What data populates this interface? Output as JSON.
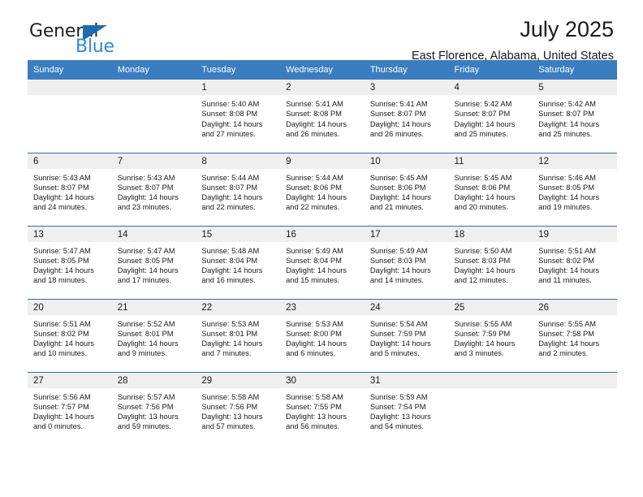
{
  "brand": {
    "name_part1": "General",
    "name_part2": "Blue",
    "triangle_icon": "triangle-icon",
    "colors": {
      "dark": "#231f20",
      "blue": "#2e8bd4",
      "triangle": "#1b6cb0"
    }
  },
  "header": {
    "title": "July 2025",
    "subtitle": "East Florence, Alabama, United States"
  },
  "theme": {
    "header_bg": "#3b7dbf",
    "row_divider": "#2f6fae",
    "daynum_bg": "#efefef"
  },
  "calendar": {
    "weekday_headers": [
      "Sunday",
      "Monday",
      "Tuesday",
      "Wednesday",
      "Thursday",
      "Friday",
      "Saturday"
    ],
    "weeks": [
      [
        {
          "day": "",
          "lines": []
        },
        {
          "day": "",
          "lines": []
        },
        {
          "day": "1",
          "lines": [
            "Sunrise: 5:40 AM",
            "Sunset: 8:08 PM",
            "Daylight: 14 hours",
            "and 27 minutes."
          ]
        },
        {
          "day": "2",
          "lines": [
            "Sunrise: 5:41 AM",
            "Sunset: 8:08 PM",
            "Daylight: 14 hours",
            "and 26 minutes."
          ]
        },
        {
          "day": "3",
          "lines": [
            "Sunrise: 5:41 AM",
            "Sunset: 8:07 PM",
            "Daylight: 14 hours",
            "and 26 minutes."
          ]
        },
        {
          "day": "4",
          "lines": [
            "Sunrise: 5:42 AM",
            "Sunset: 8:07 PM",
            "Daylight: 14 hours",
            "and 25 minutes."
          ]
        },
        {
          "day": "5",
          "lines": [
            "Sunrise: 5:42 AM",
            "Sunset: 8:07 PM",
            "Daylight: 14 hours",
            "and 25 minutes."
          ]
        }
      ],
      [
        {
          "day": "6",
          "lines": [
            "Sunrise: 5:43 AM",
            "Sunset: 8:07 PM",
            "Daylight: 14 hours",
            "and 24 minutes."
          ]
        },
        {
          "day": "7",
          "lines": [
            "Sunrise: 5:43 AM",
            "Sunset: 8:07 PM",
            "Daylight: 14 hours",
            "and 23 minutes."
          ]
        },
        {
          "day": "8",
          "lines": [
            "Sunrise: 5:44 AM",
            "Sunset: 8:07 PM",
            "Daylight: 14 hours",
            "and 22 minutes."
          ]
        },
        {
          "day": "9",
          "lines": [
            "Sunrise: 5:44 AM",
            "Sunset: 8:06 PM",
            "Daylight: 14 hours",
            "and 22 minutes."
          ]
        },
        {
          "day": "10",
          "lines": [
            "Sunrise: 5:45 AM",
            "Sunset: 8:06 PM",
            "Daylight: 14 hours",
            "and 21 minutes."
          ]
        },
        {
          "day": "11",
          "lines": [
            "Sunrise: 5:45 AM",
            "Sunset: 8:06 PM",
            "Daylight: 14 hours",
            "and 20 minutes."
          ]
        },
        {
          "day": "12",
          "lines": [
            "Sunrise: 5:46 AM",
            "Sunset: 8:05 PM",
            "Daylight: 14 hours",
            "and 19 minutes."
          ]
        }
      ],
      [
        {
          "day": "13",
          "lines": [
            "Sunrise: 5:47 AM",
            "Sunset: 8:05 PM",
            "Daylight: 14 hours",
            "and 18 minutes."
          ]
        },
        {
          "day": "14",
          "lines": [
            "Sunrise: 5:47 AM",
            "Sunset: 8:05 PM",
            "Daylight: 14 hours",
            "and 17 minutes."
          ]
        },
        {
          "day": "15",
          "lines": [
            "Sunrise: 5:48 AM",
            "Sunset: 8:04 PM",
            "Daylight: 14 hours",
            "and 16 minutes."
          ]
        },
        {
          "day": "16",
          "lines": [
            "Sunrise: 5:49 AM",
            "Sunset: 8:04 PM",
            "Daylight: 14 hours",
            "and 15 minutes."
          ]
        },
        {
          "day": "17",
          "lines": [
            "Sunrise: 5:49 AM",
            "Sunset: 8:03 PM",
            "Daylight: 14 hours",
            "and 14 minutes."
          ]
        },
        {
          "day": "18",
          "lines": [
            "Sunrise: 5:50 AM",
            "Sunset: 8:03 PM",
            "Daylight: 14 hours",
            "and 12 minutes."
          ]
        },
        {
          "day": "19",
          "lines": [
            "Sunrise: 5:51 AM",
            "Sunset: 8:02 PM",
            "Daylight: 14 hours",
            "and 11 minutes."
          ]
        }
      ],
      [
        {
          "day": "20",
          "lines": [
            "Sunrise: 5:51 AM",
            "Sunset: 8:02 PM",
            "Daylight: 14 hours",
            "and 10 minutes."
          ]
        },
        {
          "day": "21",
          "lines": [
            "Sunrise: 5:52 AM",
            "Sunset: 8:01 PM",
            "Daylight: 14 hours",
            "and 9 minutes."
          ]
        },
        {
          "day": "22",
          "lines": [
            "Sunrise: 5:53 AM",
            "Sunset: 8:01 PM",
            "Daylight: 14 hours",
            "and 7 minutes."
          ]
        },
        {
          "day": "23",
          "lines": [
            "Sunrise: 5:53 AM",
            "Sunset: 8:00 PM",
            "Daylight: 14 hours",
            "and 6 minutes."
          ]
        },
        {
          "day": "24",
          "lines": [
            "Sunrise: 5:54 AM",
            "Sunset: 7:59 PM",
            "Daylight: 14 hours",
            "and 5 minutes."
          ]
        },
        {
          "day": "25",
          "lines": [
            "Sunrise: 5:55 AM",
            "Sunset: 7:59 PM",
            "Daylight: 14 hours",
            "and 3 minutes."
          ]
        },
        {
          "day": "26",
          "lines": [
            "Sunrise: 5:55 AM",
            "Sunset: 7:58 PM",
            "Daylight: 14 hours",
            "and 2 minutes."
          ]
        }
      ],
      [
        {
          "day": "27",
          "lines": [
            "Sunrise: 5:56 AM",
            "Sunset: 7:57 PM",
            "Daylight: 14 hours",
            "and 0 minutes."
          ]
        },
        {
          "day": "28",
          "lines": [
            "Sunrise: 5:57 AM",
            "Sunset: 7:56 PM",
            "Daylight: 13 hours",
            "and 59 minutes."
          ]
        },
        {
          "day": "29",
          "lines": [
            "Sunrise: 5:58 AM",
            "Sunset: 7:56 PM",
            "Daylight: 13 hours",
            "and 57 minutes."
          ]
        },
        {
          "day": "30",
          "lines": [
            "Sunrise: 5:58 AM",
            "Sunset: 7:55 PM",
            "Daylight: 13 hours",
            "and 56 minutes."
          ]
        },
        {
          "day": "31",
          "lines": [
            "Sunrise: 5:59 AM",
            "Sunset: 7:54 PM",
            "Daylight: 13 hours",
            "and 54 minutes."
          ]
        },
        {
          "day": "",
          "lines": []
        },
        {
          "day": "",
          "lines": []
        }
      ]
    ]
  }
}
